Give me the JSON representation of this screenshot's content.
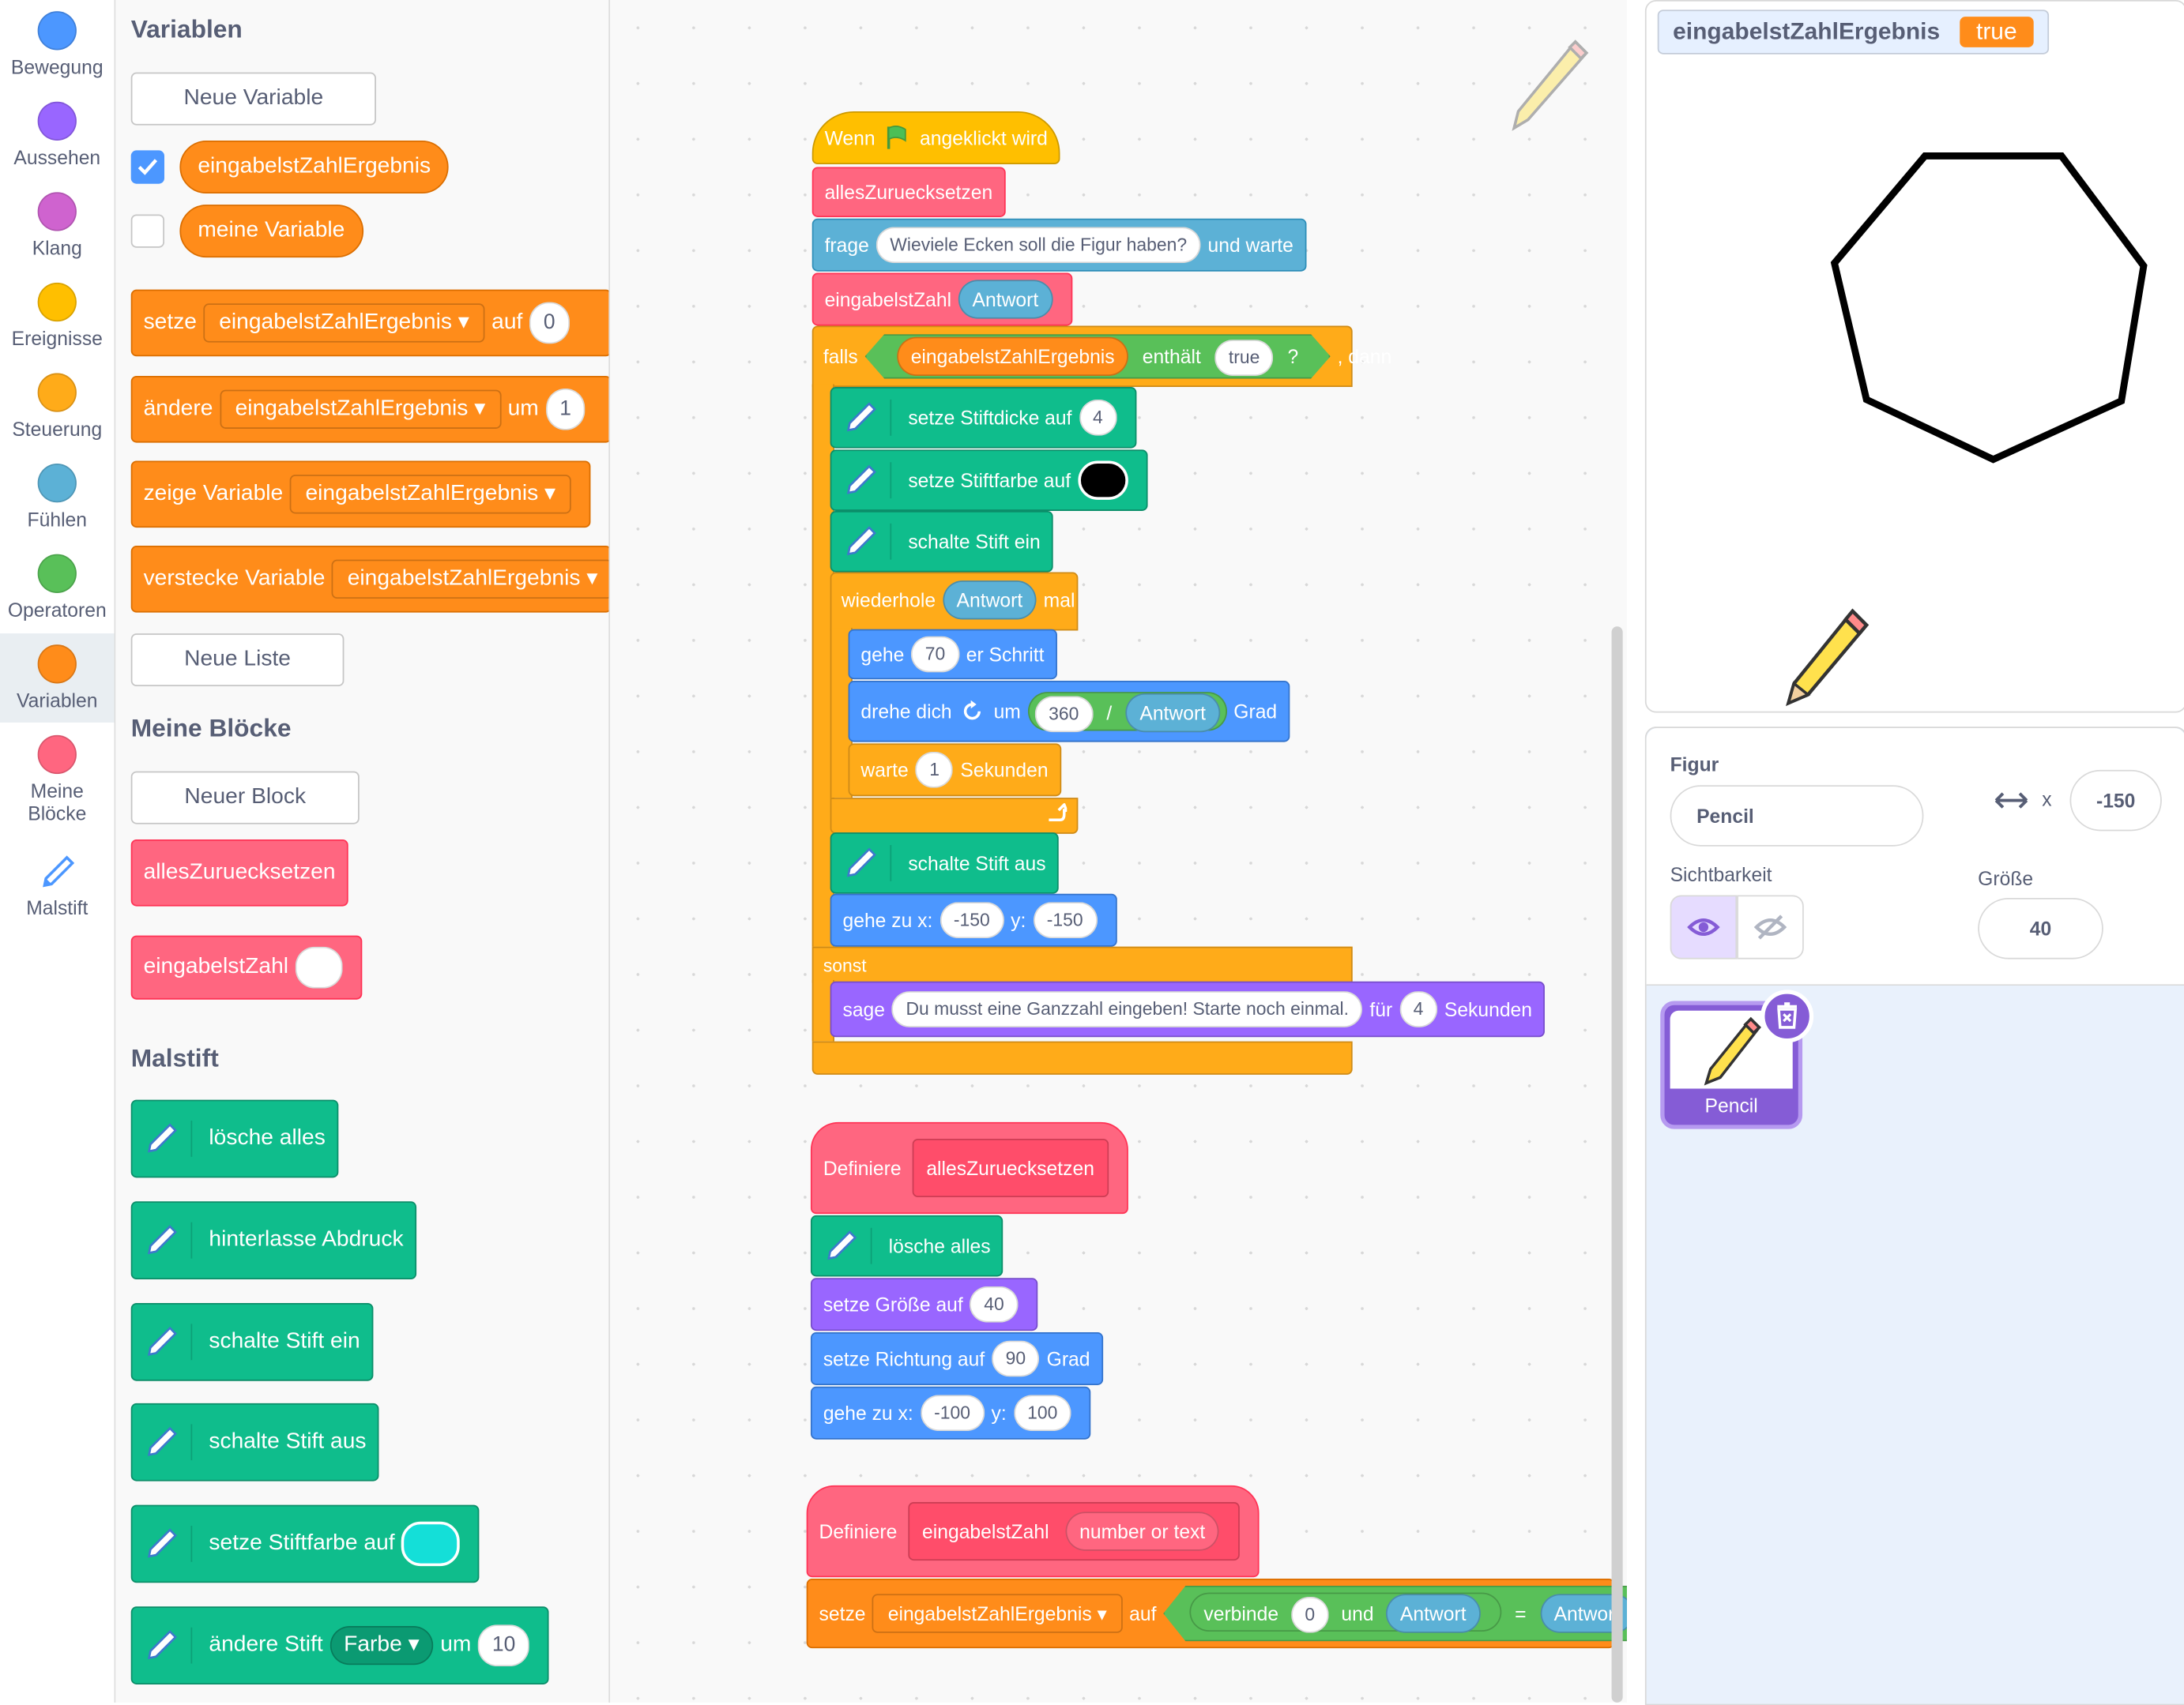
{
  "categories": [
    {
      "label": "Bewegung",
      "color": "#4c97ff"
    },
    {
      "label": "Aussehen",
      "color": "#9966ff"
    },
    {
      "label": "Klang",
      "color": "#cf63cf"
    },
    {
      "label": "Ereignisse",
      "color": "#ffbf00"
    },
    {
      "label": "Steuerung",
      "color": "#ffab19"
    },
    {
      "label": "Fühlen",
      "color": "#5cb1d6"
    },
    {
      "label": "Operatoren",
      "color": "#59c059"
    },
    {
      "label": "Variablen",
      "color": "#ff8c1a"
    },
    {
      "label": "Meine Blöcke",
      "color": "#ff6680"
    },
    {
      "label": "Malstift",
      "color": "#0fbd8c"
    }
  ],
  "palette": {
    "variablen_title": "Variablen",
    "neue_variable": "Neue Variable",
    "var1": "eingabelstZahlErgebnis",
    "var2": "meine Variable",
    "setze": "setze",
    "auf": "auf",
    "setze_val": "0",
    "aendere": "ändere",
    "um": "um",
    "aendere_val": "1",
    "zeige_variable": "zeige Variable",
    "verstecke_variable": "verstecke Variable",
    "neue_liste": "Neue Liste",
    "meine_bloecke_title": "Meine Blöcke",
    "neuer_block": "Neuer Block",
    "alles_zuruecksetzen": "allesZuruecksetzen",
    "eingabelst_zahl": "eingabelstZahl",
    "malstift_title": "Malstift",
    "loesche_alles": "lösche alles",
    "hinterlasse_abdruck": "hinterlasse Abdruck",
    "schalte_stift_ein": "schalte Stift ein",
    "schalte_stift_aus": "schalte Stift aus",
    "setze_stiftfarbe_auf": "setze Stiftfarbe auf",
    "aendere_stift": "ändere Stift",
    "farbe": "Farbe",
    "um_val": "10"
  },
  "script1": {
    "hat_wenn": "Wenn",
    "hat_angeklickt": "angeklickt wird",
    "alles_zuruecksetzen": "allesZuruecksetzen",
    "frage": "frage",
    "frage_text": "Wieviele Ecken soll die Figur haben?",
    "und_warte": "und warte",
    "eingabelst_zahl": "eingabelstZahl",
    "antwort": "Antwort",
    "falls": "falls",
    "var": "eingabelstZahlErgebnis",
    "enthaelt": "enthält",
    "true_val": "true",
    "q": "?",
    "dann": ", dann",
    "setze_stiftdicke": "setze Stiftdicke auf",
    "stiftdicke_val": "4",
    "setze_stiftfarbe": "setze Stiftfarbe auf",
    "schalte_ein": "schalte Stift ein",
    "wiederhole": "wiederhole",
    "mal": "mal",
    "gehe": "gehe",
    "gehe_val": "70",
    "er_schritt": "er Schritt",
    "drehe_dich": "drehe dich",
    "um": "um",
    "deg_val": "360",
    "slash": "/",
    "grad": "Grad",
    "warte": "warte",
    "warte_val": "1",
    "sekunden": "Sekunden",
    "schalte_aus": "schalte Stift aus",
    "gehe_zu_x": "gehe zu x:",
    "x_val": "-150",
    "y_label": "y:",
    "y_val": "-150",
    "sonst": "sonst",
    "sage": "sage",
    "sage_text": "Du musst eine Ganzzahl eingeben! Starte noch einmal.",
    "fuer": "für",
    "fuer_val": "4"
  },
  "script2": {
    "definiere": "Definiere",
    "name": "allesZuruecksetzen",
    "loesche_alles": "lösche alles",
    "setze_groesse": "setze Größe auf",
    "groesse_val": "40",
    "setze_richtung": "setze Richtung auf",
    "richtung_val": "90",
    "grad": "Grad",
    "gehe_zu_x": "gehe zu x:",
    "x_val": "-100",
    "y_label": "y:",
    "y_val": "100"
  },
  "script3": {
    "definiere": "Definiere",
    "name": "eingabelstZahl",
    "param": "number or text",
    "setze": "setze",
    "var": "eingabelstZahlErgebnis",
    "auf": "auf",
    "verbinde": "verbinde",
    "verbinde_val": "0",
    "und": "und",
    "antwort": "Antwort",
    "eq": "=",
    "antwort2": "Antwort"
  },
  "stage": {
    "monitor_name": "eingabelstZahlErgebnis",
    "monitor_value": "true"
  },
  "sprite_info": {
    "figur_label": "Figur",
    "figur_name": "Pencil",
    "x_label": "x",
    "x_value": "-150",
    "sichtbarkeit_label": "Sichtbarkeit",
    "groesse_label": "Größe",
    "groesse_value": "40",
    "sprite_tile_name": "Pencil"
  }
}
